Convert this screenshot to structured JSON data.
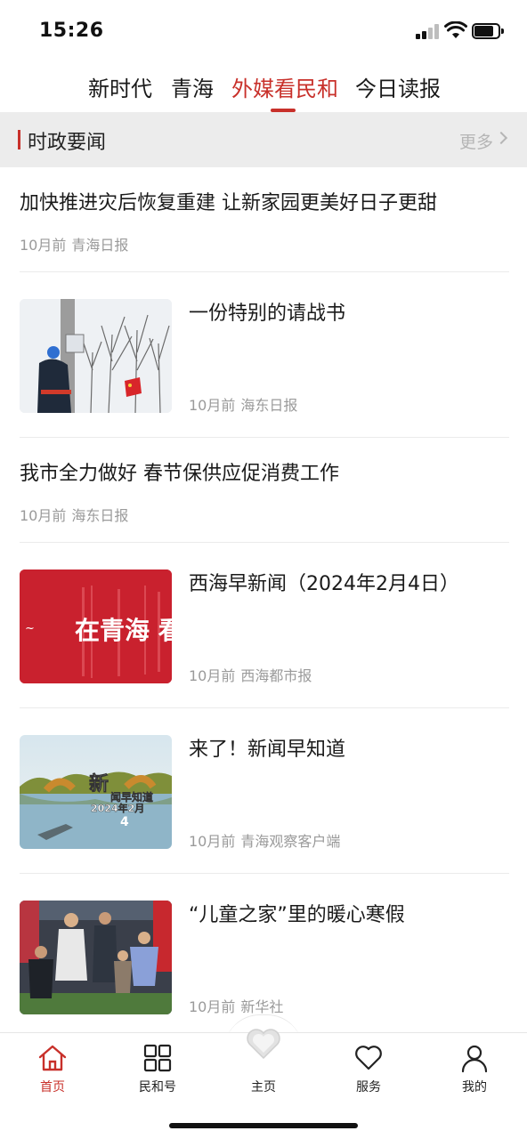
{
  "status_bar": {
    "time": "15:26"
  },
  "top_tabs": [
    {
      "label": "新时代"
    },
    {
      "label": "青海"
    },
    {
      "label": "外媒看民和",
      "active": true
    },
    {
      "label": "今日读报"
    }
  ],
  "section": {
    "title": "时政要闻",
    "more": "更多"
  },
  "news": [
    {
      "title": "加快推进灾后恢复重建 让新家园更美好日子更甜",
      "time": "10月前",
      "source": "青海日报"
    },
    {
      "title": "一份特别的请战书",
      "time": "10月前",
      "source": "海东日报",
      "thumb": "worker-on-pole"
    },
    {
      "title": "我市全力做好 春节保供应促消费工作",
      "time": "10月前",
      "source": "海东日报"
    },
    {
      "title": "西海早新闻（2024年2月4日）",
      "time": "10月前",
      "source": "西海都市报",
      "thumb": "red-banner",
      "thumb_text": "在青海 看西海"
    },
    {
      "title": "来了！新闻早知道",
      "time": "10月前",
      "source": "青海观察客户端",
      "thumb": "lake-scene",
      "thumb_text": [
        "新",
        "闻早知道",
        "2024年2月",
        "4"
      ]
    },
    {
      "title": "“儿童之家”里的暖心寒假",
      "time": "10月前",
      "source": "新华社",
      "thumb": "children-group"
    }
  ],
  "bottom_nav": [
    {
      "label": "首页",
      "icon": "home-icon",
      "active": true
    },
    {
      "label": "民和号",
      "icon": "grid-icon"
    },
    {
      "label": "主页",
      "icon": "heart-logo-icon"
    },
    {
      "label": "服务",
      "icon": "heart-icon"
    },
    {
      "label": "我的",
      "icon": "user-icon"
    }
  ],
  "colors": {
    "accent": "#c8302a",
    "section_bg": "#ececec",
    "meta_text": "#9a9a9a"
  }
}
